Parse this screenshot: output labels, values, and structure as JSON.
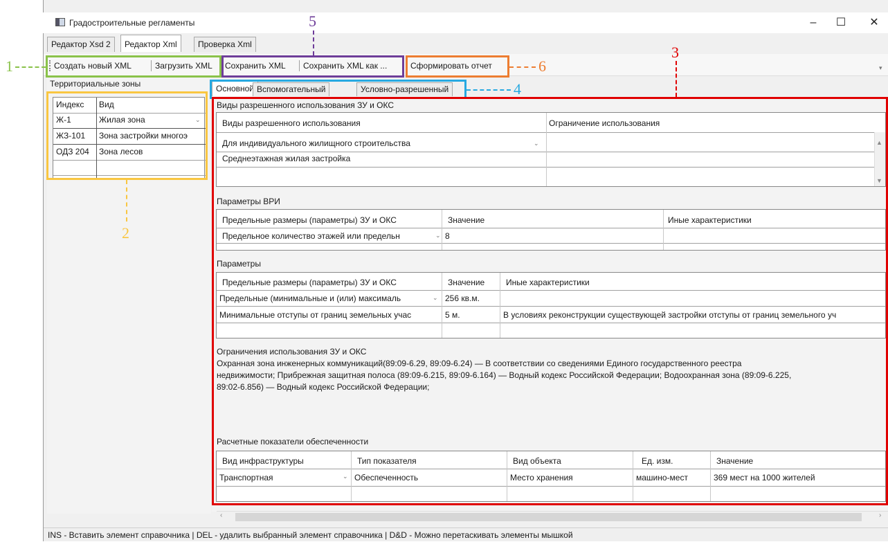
{
  "window": {
    "title": "Градостроительные регламенты",
    "controls": {
      "minimize": "–",
      "maximize": "☐",
      "close": "✕"
    }
  },
  "main_tabs": [
    "Редактор Xsd 2",
    "Редактор Xml",
    "Проверка Xml"
  ],
  "toolbar": {
    "create_new": "Создать новый XML",
    "load": "Загрузить XML",
    "save": "Сохранить XML",
    "save_as": "Сохранить XML как ...",
    "report": "Сформировать отчет"
  },
  "callouts": {
    "c1": "1",
    "c2": "2",
    "c3": "3",
    "c4": "4",
    "c5": "5",
    "c6": "6"
  },
  "colors": {
    "green": "#8ac24a",
    "yellow": "#f9c641",
    "red": "#e00000",
    "blue": "#27a9e1",
    "purple": "#6e3d99",
    "orange": "#ed7d31"
  },
  "zones": {
    "title": "Территориальные зоны",
    "headers": [
      "Индекс",
      "Вид"
    ],
    "rows": [
      [
        "Ж-1",
        "Жилая зона"
      ],
      [
        "ЖЗ-101",
        "Зона застройки многоэ"
      ],
      [
        "ОДЗ 204",
        "Зона лесов"
      ]
    ]
  },
  "sub_tabs": [
    "Основной",
    "Вспомогательный",
    "Условно-разрешенный"
  ],
  "vri": {
    "title": "Виды разрешенного использования ЗУ и ОКС",
    "headers": [
      "Виды разрешенного использования",
      "Ограничение использования"
    ],
    "rows": [
      [
        "Для индивидуального жилищного строительства",
        ""
      ],
      [
        "Среднеэтажная жилая застройка",
        ""
      ]
    ]
  },
  "vri_params": {
    "title": "Параметры ВРИ",
    "headers": [
      "Предельные размеры (параметры) ЗУ и ОКС",
      "Значение",
      "Иные характеристики"
    ],
    "rows": [
      [
        "Предельное количество этажей или предельн",
        "8",
        ""
      ]
    ]
  },
  "params": {
    "title": "Параметры",
    "headers": [
      "Предельные размеры (параметры) ЗУ и ОКС",
      "Значение",
      "Иные характеристики"
    ],
    "rows": [
      [
        "Предельные (минимальные и (или) максималь",
        "256 кв.м.",
        ""
      ],
      [
        "Минимальные отступы от границ земельных учас",
        "5 м.",
        "В условиях реконструкции существующей застройки отступы от границ земельного уч"
      ]
    ]
  },
  "restrictions": {
    "title": "Ограничения использования ЗУ и ОКС",
    "lines": [
      "Охранная зона инженерных коммуникаций(89:09-6.29, 89:09-6.24) — В соответствии со сведениями Единого государственного реестра",
      "недвижимости; Прибрежная защитная полоса (89:09-6.215, 89:09-6.164) — Водный кодекс Российской Федерации; Водоохранная зона (89:09-6.225,",
      "89:02-6.856) — Водный кодекс Российской Федерации;"
    ]
  },
  "provision": {
    "title": "Расчетные показатели обеспеченности",
    "headers": [
      "Вид инфраструктуры",
      "Тип показателя",
      "Вид объекта",
      "Ед. изм.",
      "Значение"
    ],
    "rows": [
      [
        "Транспортная",
        "Обеспеченность",
        "Место хранения",
        "машино-мест",
        "369 мест на 1000 жителей"
      ]
    ]
  },
  "status_bar": "INS - Вставить элемент справочника | DEL - удалить выбранный элемент справочника | D&D - Можно перетаскивать элементы мышкой"
}
